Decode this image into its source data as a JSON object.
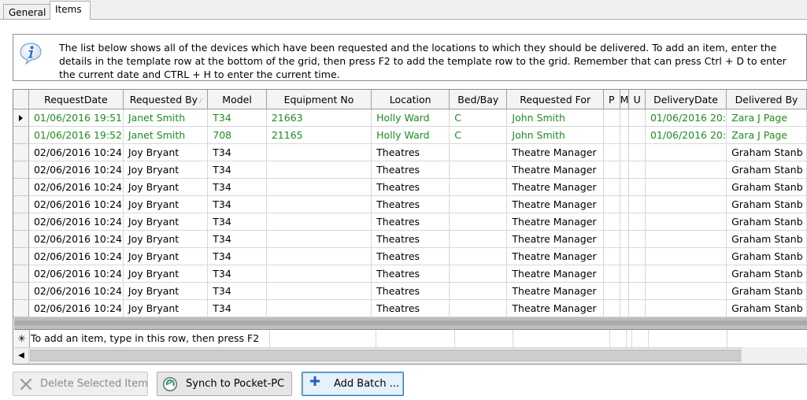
{
  "tabs": [
    {
      "label": "General",
      "active": false
    },
    {
      "label": "Items",
      "active": true
    }
  ],
  "info": {
    "icon": "info-icon",
    "text": "The list below shows all of the devices which have been requested and the locations to which they should be delivered. To add an item, enter the details in the template row at the bottom of the grid, then press F2 to add the template row to the grid. Remember that can press Ctrl + D to enter the current date and CTRL + H to enter the current time."
  },
  "grid": {
    "columns": [
      "RequestDate",
      "Requested By",
      "Model",
      "Equipment No",
      "Location",
      "Bed/Bay",
      "Requested For",
      "P",
      "M",
      "U",
      "DeliveryDate",
      "Delivered By"
    ],
    "sorted_column": "Requested By",
    "rows": [
      {
        "cells": [
          "01/06/2016 19:51",
          "Janet Smith",
          "T34",
          "21663",
          "Holly Ward",
          "C",
          "John Smith",
          "",
          "",
          "",
          "01/06/2016 20:",
          "Zara J Page"
        ],
        "current": true,
        "highlight": "green"
      },
      {
        "cells": [
          "01/06/2016 19:52",
          "Janet Smith",
          "708",
          "21165",
          "Holly Ward",
          "C",
          "John Smith",
          "",
          "",
          "",
          "01/06/2016 20:",
          "Zara J Page"
        ],
        "current": false,
        "highlight": "green"
      },
      {
        "cells": [
          "02/06/2016 10:24",
          "Joy Bryant",
          "T34",
          "",
          "Theatres",
          "",
          "Theatre Manager",
          "",
          "",
          "",
          "",
          "Graham Stanb"
        ],
        "current": false,
        "highlight": ""
      },
      {
        "cells": [
          "02/06/2016 10:24",
          "Joy Bryant",
          "T34",
          "",
          "Theatres",
          "",
          "Theatre Manager",
          "",
          "",
          "",
          "",
          "Graham Stanb"
        ],
        "current": false,
        "highlight": ""
      },
      {
        "cells": [
          "02/06/2016 10:24",
          "Joy Bryant",
          "T34",
          "",
          "Theatres",
          "",
          "Theatre Manager",
          "",
          "",
          "",
          "",
          "Graham Stanb"
        ],
        "current": false,
        "highlight": ""
      },
      {
        "cells": [
          "02/06/2016 10:24",
          "Joy Bryant",
          "T34",
          "",
          "Theatres",
          "",
          "Theatre Manager",
          "",
          "",
          "",
          "",
          "Graham Stanb"
        ],
        "current": false,
        "highlight": ""
      },
      {
        "cells": [
          "02/06/2016 10:24",
          "Joy Bryant",
          "T34",
          "",
          "Theatres",
          "",
          "Theatre Manager",
          "",
          "",
          "",
          "",
          "Graham Stanb"
        ],
        "current": false,
        "highlight": ""
      },
      {
        "cells": [
          "02/06/2016 10:24",
          "Joy Bryant",
          "T34",
          "",
          "Theatres",
          "",
          "Theatre Manager",
          "",
          "",
          "",
          "",
          "Graham Stanb"
        ],
        "current": false,
        "highlight": ""
      },
      {
        "cells": [
          "02/06/2016 10:24",
          "Joy Bryant",
          "T34",
          "",
          "Theatres",
          "",
          "Theatre Manager",
          "",
          "",
          "",
          "",
          "Graham Stanb"
        ],
        "current": false,
        "highlight": ""
      },
      {
        "cells": [
          "02/06/2016 10:24",
          "Joy Bryant",
          "T34",
          "",
          "Theatres",
          "",
          "Theatre Manager",
          "",
          "",
          "",
          "",
          "Graham Stanb"
        ],
        "current": false,
        "highlight": ""
      },
      {
        "cells": [
          "02/06/2016 10:24",
          "Joy Bryant",
          "T34",
          "",
          "Theatres",
          "",
          "Theatre Manager",
          "",
          "",
          "",
          "",
          "Graham Stanb"
        ],
        "current": false,
        "highlight": ""
      },
      {
        "cells": [
          "02/06/2016 10:24",
          "Joy Bryant",
          "T34",
          "",
          "Theatres",
          "",
          "Theatre Manager",
          "",
          "",
          "",
          "",
          "Graham Stanb"
        ],
        "current": false,
        "highlight": ""
      }
    ],
    "template_row_text": "To add an item, type in this row, then press F2",
    "template_row_marker": "✳",
    "scroll_left_glyph": "◀"
  },
  "buttons": {
    "delete": {
      "label": "Delete Selected Item",
      "enabled": false,
      "icon": "x-icon"
    },
    "synch": {
      "label": "Synch to Pocket-PC",
      "enabled": true,
      "icon": "sync-globe-icon"
    },
    "batch": {
      "label": "Add Batch ...",
      "enabled": true,
      "icon": "plus-icon"
    }
  },
  "colors": {
    "green_text": "#1e8c1e",
    "info_icon": "#2a6cc0"
  }
}
